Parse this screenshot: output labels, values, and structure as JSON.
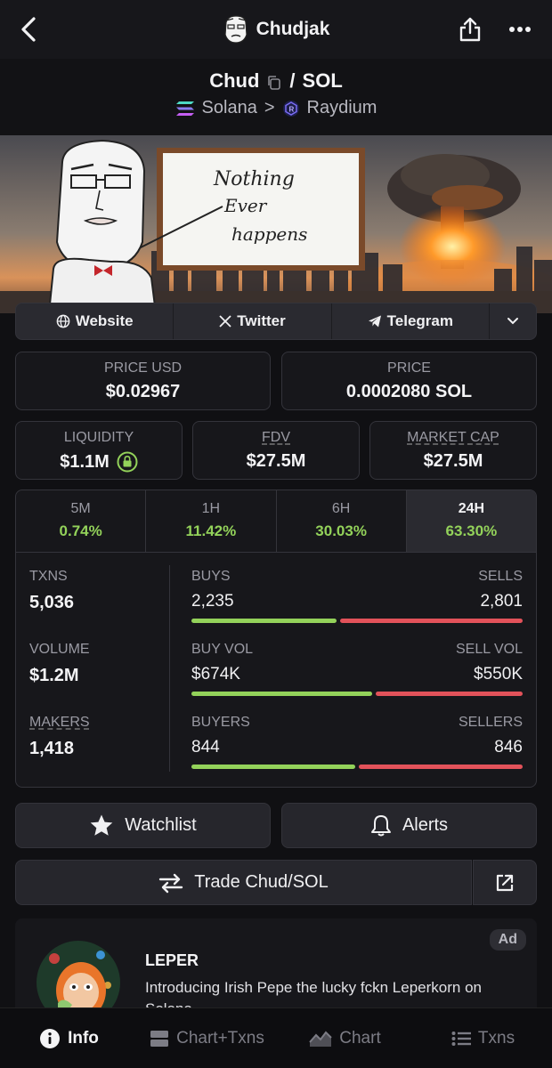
{
  "header": {
    "title": "Chudjak"
  },
  "pair": {
    "base": "Chud",
    "separator": "/",
    "quote": "SOL",
    "chain": "Solana",
    "chevron": ">",
    "dex": "Raydium"
  },
  "banner": {
    "sign_line1": "Nothing",
    "sign_line2": "Ever",
    "sign_line3": "happens"
  },
  "links": {
    "website": "Website",
    "twitter": "Twitter",
    "telegram": "Telegram"
  },
  "prices": {
    "price_usd_label": "PRICE USD",
    "price_usd": "$0.02967",
    "price_label": "PRICE",
    "price": "0.0002080 SOL"
  },
  "metrics": {
    "liquidity_label": "LIQUIDITY",
    "liquidity": "$1.1M",
    "fdv_label": "FDV",
    "fdv": "$27.5M",
    "mcap_label": "MARKET CAP",
    "mcap": "$27.5M"
  },
  "periods": [
    {
      "label": "5M",
      "change": "0.74%"
    },
    {
      "label": "1H",
      "change": "11.42%"
    },
    {
      "label": "6H",
      "change": "30.03%"
    },
    {
      "label": "24H",
      "change": "63.30%"
    }
  ],
  "stats": {
    "txns_label": "TXNS",
    "txns": "5,036",
    "buys_label": "BUYS",
    "buys": "2,235",
    "sells_label": "SELLS",
    "sells": "2,801",
    "buys_share": 0.444,
    "volume_label": "VOLUME",
    "volume": "$1.2M",
    "buy_vol_label": "BUY VOL",
    "buy_vol": "$674K",
    "sell_vol_label": "SELL VOL",
    "sell_vol": "$550K",
    "buy_vol_share": 0.551,
    "makers_label": "MAKERS",
    "makers": "1,418",
    "buyers_label": "BUYERS",
    "buyers": "844",
    "sellers_label": "SELLERS",
    "sellers": "846",
    "buyers_share": 0.499
  },
  "actions": {
    "watchlist": "Watchlist",
    "alerts": "Alerts",
    "trade": "Trade Chud/SOL"
  },
  "ad": {
    "badge": "Ad",
    "title": "LEPER",
    "text": "Introducing Irish Pepe the lucky fckn Leperkorn on Solana"
  },
  "tabs": [
    {
      "label": "Info"
    },
    {
      "label": "Chart+Txns"
    },
    {
      "label": "Chart"
    },
    {
      "label": "Txns"
    }
  ],
  "colors": {
    "positive": "#93d25a",
    "negative": "#e2525a",
    "background": "#101013"
  }
}
